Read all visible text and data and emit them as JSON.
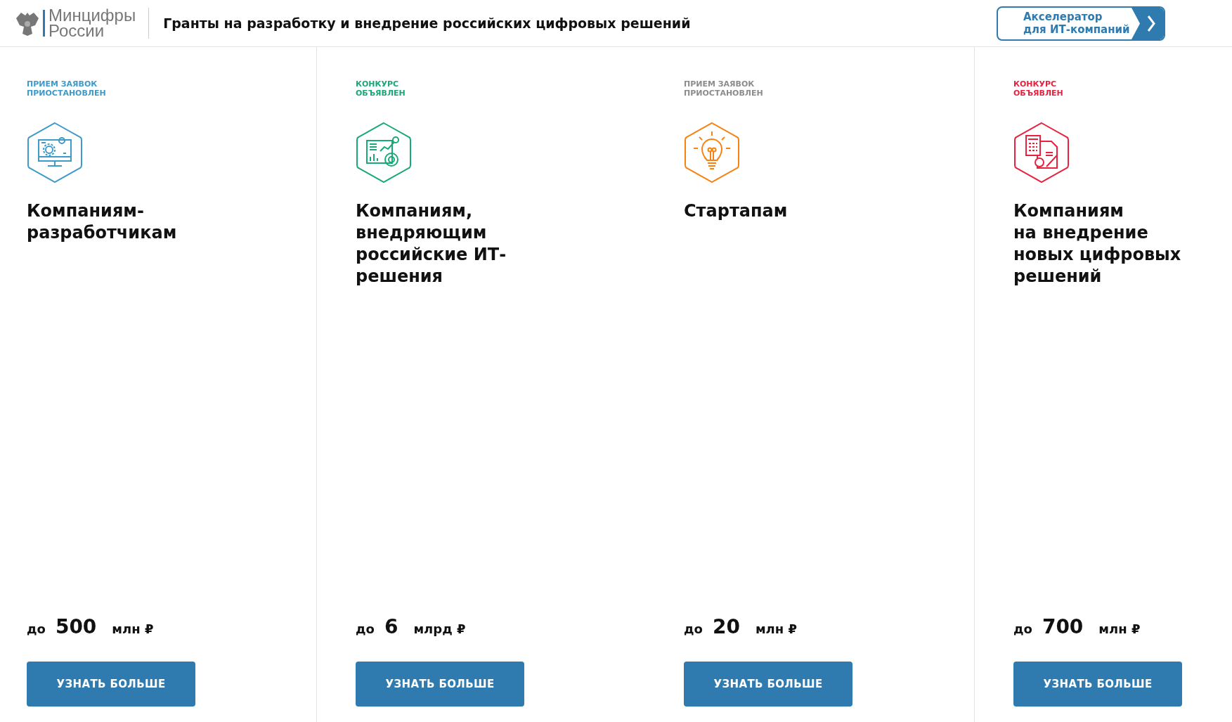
{
  "header": {
    "logo_lines": [
      "Минцифры",
      "России"
    ],
    "title": "Гранты на разработку и внедрение российских цифровых решений",
    "accelerator_button": {
      "lines": [
        "Акселератор",
        "для ИТ-компаний"
      ]
    }
  },
  "cards": [
    {
      "status": [
        "ПРИЕМ ЗАЯВОК",
        "ПРИОСТАНОВЛЕН"
      ],
      "color": "#3e9ac9",
      "kind": "monitor",
      "title": [
        "Компаниям-",
        "разработчикам"
      ],
      "amount": {
        "prefix": "до",
        "value": "500",
        "unit": "млн ₽"
      },
      "button": "УЗНАТЬ БОЛЬШЕ"
    },
    {
      "status": [
        "КОНКУРС",
        "ОБЪЯВЛЕН"
      ],
      "color": "#19a878",
      "kind": "chart",
      "title": [
        "Компаниям,",
        "внедряющим",
        "российские ИТ-",
        "решения"
      ],
      "amount": {
        "prefix": "до",
        "value": "6",
        "unit": "млрд ₽"
      },
      "button": "УЗНАТЬ БОЛЬШЕ"
    },
    {
      "status": [
        "ПРИЕМ ЗАЯВОК",
        "ПРИОСТАНОВЛЕН"
      ],
      "color": "#8c8c8c",
      "kind": "bulb",
      "title": [
        "Стартапам"
      ],
      "amount": {
        "prefix": "до",
        "value": "20",
        "unit": "млн ₽"
      },
      "button": "УЗНАТЬ БОЛЬШЕ"
    },
    {
      "status": [
        "КОНКУРС",
        "ОБЪЯВЛЕН"
      ],
      "color": "#e8213f",
      "kind": "calculator",
      "title": [
        "Компаниям",
        "на внедрение",
        "новых цифровых",
        "решений"
      ],
      "amount": {
        "prefix": "до",
        "value": "700",
        "unit": "млн ₽"
      },
      "button": "УЗНАТЬ БОЛЬШЕ"
    }
  ]
}
